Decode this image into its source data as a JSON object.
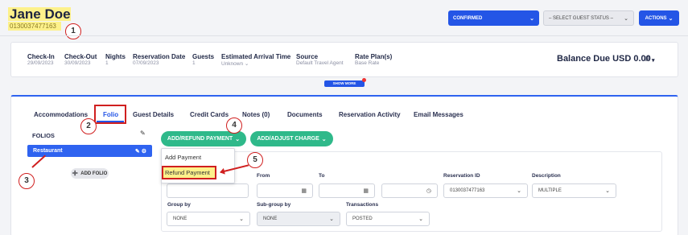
{
  "header": {
    "guest_name": "Jane Doe",
    "reservation_number": "0130037477163",
    "status_label": "CONFIRMED",
    "guest_status_placeholder": "– SELECT GUEST STATUS –",
    "actions_label": "ACTIONS"
  },
  "summary": {
    "fields": [
      {
        "label": "Check-In",
        "value": "29/09/2023"
      },
      {
        "label": "Check-Out",
        "value": "30/09/2023"
      },
      {
        "label": "Nights",
        "value": "1"
      },
      {
        "label": "Reservation Date",
        "value": "07/09/2023"
      },
      {
        "label": "Guests",
        "value": "1"
      },
      {
        "label": "Estimated Arrival Time",
        "value": "Unknown"
      },
      {
        "label": "Source",
        "value": "Default Travel Agent"
      },
      {
        "label": "Rate Plan(s)",
        "value": "Base Rate"
      }
    ],
    "balance_label": "Balance Due USD 0.00",
    "show_more_label": "SHOW MORE"
  },
  "tabs": [
    "Accommodations",
    "Folio",
    "Guest Details",
    "Credit Cards",
    "Notes (0)",
    "Documents",
    "Reservation Activity",
    "Email Messages"
  ],
  "folio": {
    "folios_heading": "FOLIOS",
    "selected_folio": "Restaurant",
    "add_folio_label": "ADD FOLIO",
    "add_refund_payment_label": "ADD/REFUND PAYMENT",
    "add_adjust_charge_label": "ADD/ADJUST CHARGE",
    "menu_items": [
      "Add Payment",
      "Refund Payment"
    ]
  },
  "filters": {
    "from_label": "From",
    "to_label": "To",
    "reservation_id_label": "Reservation ID",
    "reservation_id_value": "0130037477163",
    "description_label": "Description",
    "description_value": "MULTIPLE",
    "group_by_label": "Group by",
    "group_by_value": "NONE",
    "subgroup_by_label": "Sub-group by",
    "subgroup_by_value": "NONE",
    "transactions_label": "Transactions",
    "transactions_value": "POSTED"
  },
  "callouts": [
    "1",
    "2",
    "3",
    "4",
    "5"
  ],
  "colors": {
    "accent_blue": "#2455e6",
    "folio_blue": "#2f63f0",
    "green": "#2fb98a",
    "highlight_yellow": "#fdf18b",
    "callout_red": "#d01f1f"
  }
}
